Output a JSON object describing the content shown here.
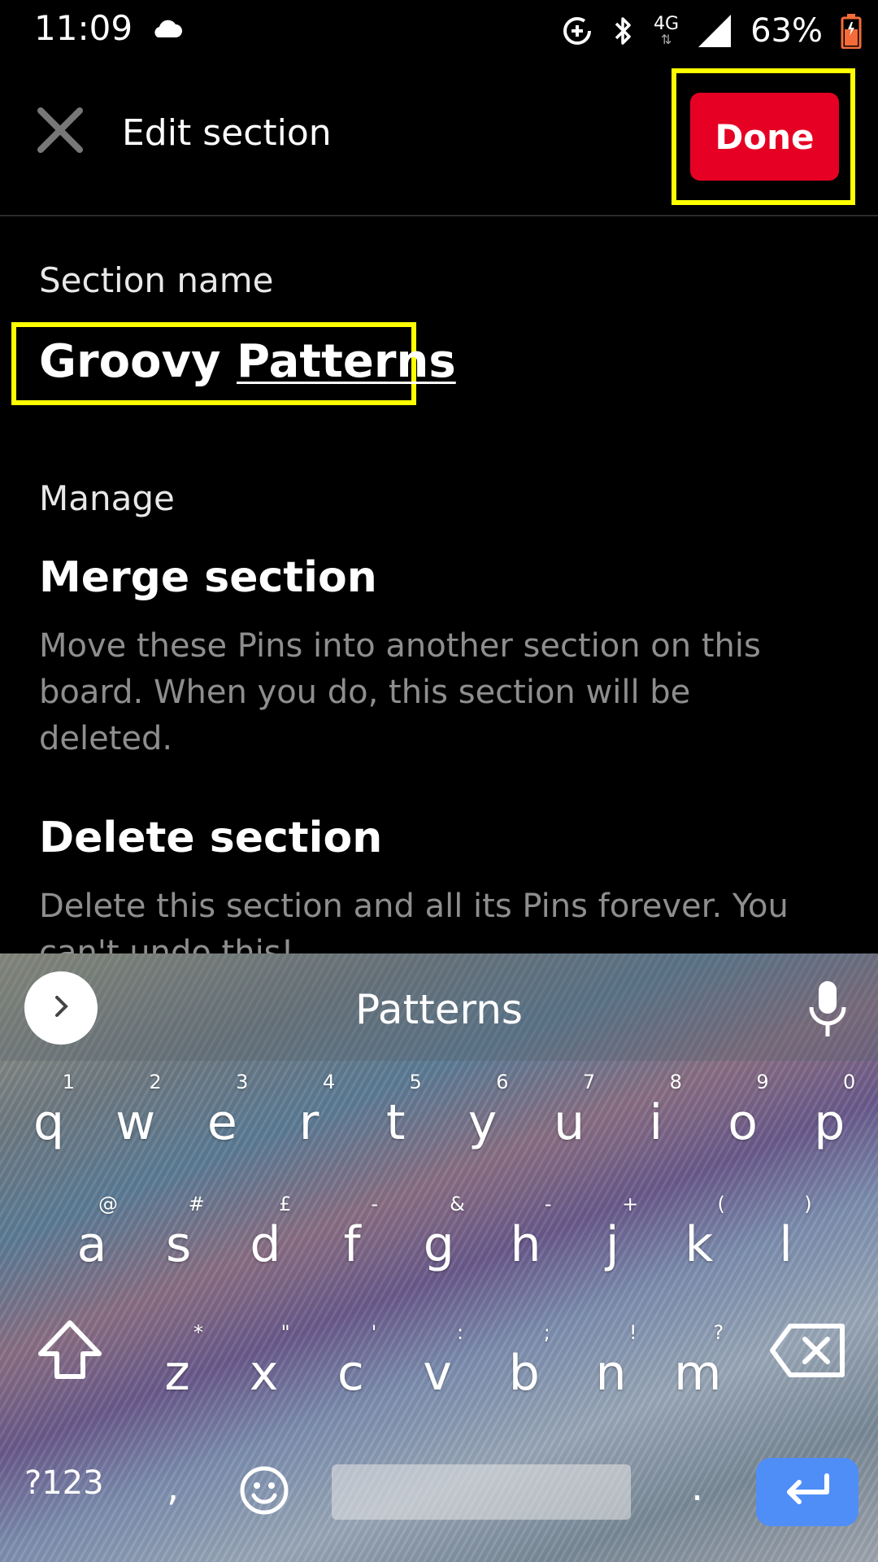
{
  "status_bar": {
    "time": "11:09",
    "network": "4G",
    "battery_percent": "63%"
  },
  "header": {
    "title": "Edit section",
    "done_label": "Done"
  },
  "section": {
    "name_label": "Section name",
    "name_word1": "Groovy",
    "name_word2": "Patterns"
  },
  "manage": {
    "label": "Manage",
    "merge_title": "Merge section",
    "merge_desc": "Move these Pins into another section on this board. When you do, this section will be deleted.",
    "delete_title": "Delete section",
    "delete_desc": "Delete this section and all its Pins forever. You can't undo this!"
  },
  "keyboard": {
    "suggestion": "Patterns",
    "row1": [
      {
        "key": "q",
        "hint": "1"
      },
      {
        "key": "w",
        "hint": "2"
      },
      {
        "key": "e",
        "hint": "3"
      },
      {
        "key": "r",
        "hint": "4"
      },
      {
        "key": "t",
        "hint": "5"
      },
      {
        "key": "y",
        "hint": "6"
      },
      {
        "key": "u",
        "hint": "7"
      },
      {
        "key": "i",
        "hint": "8"
      },
      {
        "key": "o",
        "hint": "9"
      },
      {
        "key": "p",
        "hint": "0"
      }
    ],
    "row2": [
      {
        "key": "a",
        "hint": "@"
      },
      {
        "key": "s",
        "hint": "#"
      },
      {
        "key": "d",
        "hint": "£"
      },
      {
        "key": "f",
        "hint": "-"
      },
      {
        "key": "g",
        "hint": "&"
      },
      {
        "key": "h",
        "hint": "-"
      },
      {
        "key": "j",
        "hint": "+"
      },
      {
        "key": "k",
        "hint": "("
      },
      {
        "key": "l",
        "hint": ")"
      }
    ],
    "row3": [
      {
        "key": "z",
        "hint": "*"
      },
      {
        "key": "x",
        "hint": "\""
      },
      {
        "key": "c",
        "hint": "'"
      },
      {
        "key": "v",
        "hint": ":"
      },
      {
        "key": "b",
        "hint": ";"
      },
      {
        "key": "n",
        "hint": "!"
      },
      {
        "key": "m",
        "hint": "?"
      }
    ],
    "symbols_label": "?123",
    "comma_label": ",",
    "period_label": "."
  },
  "colors": {
    "done_button": "#e60023",
    "highlight": "#ffff00",
    "enter_key": "#4f8ef7"
  },
  "icons": [
    "cloud-icon",
    "data-saver-icon",
    "bluetooth-icon",
    "signal-icon",
    "battery-icon",
    "close-icon",
    "chevron-right-icon",
    "mic-icon",
    "shift-icon",
    "backspace-icon",
    "emoji-icon",
    "enter-icon"
  ]
}
